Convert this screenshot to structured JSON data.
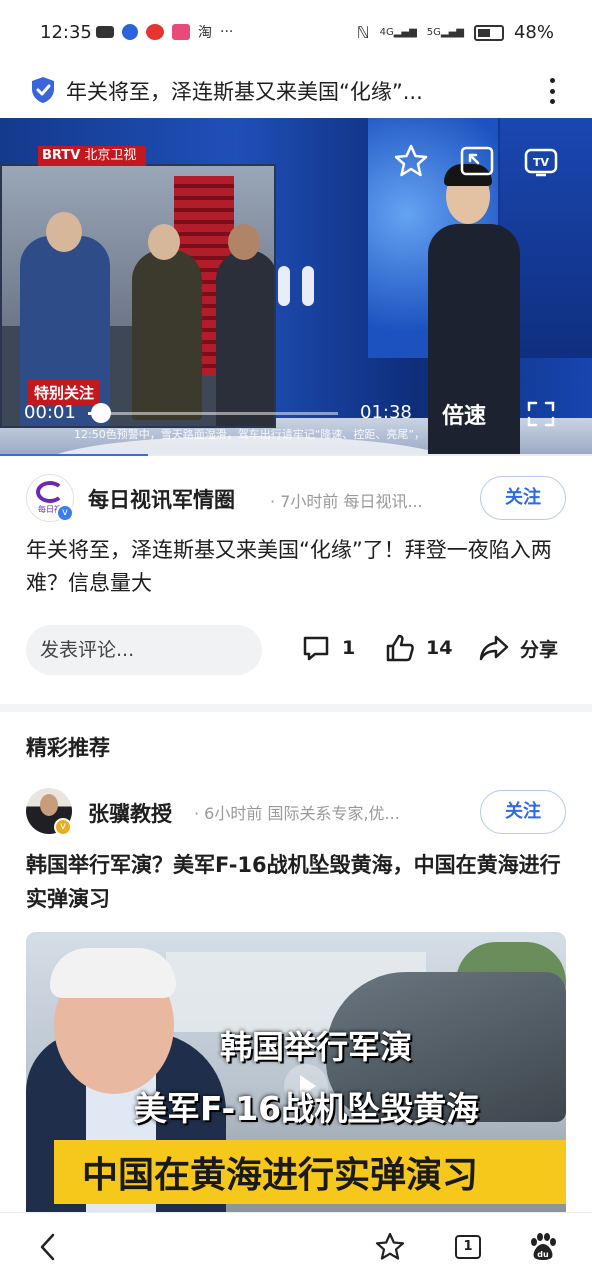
{
  "status_bar": {
    "time": "12:35",
    "left_icons": [
      "camera-icon",
      "paw-icon",
      "weibo-icon",
      "app-icon",
      "taobao-icon"
    ],
    "taobao_label": "淘",
    "more_dots": "···",
    "network_labels": [
      "4G",
      "5G"
    ],
    "battery_percent": "48%"
  },
  "title_bar": {
    "title": "年关将至，泽连斯基又来美国“化缘”..."
  },
  "video": {
    "channel_logo": "BRTV",
    "channel_name": "北京卫视",
    "special_tag": "特别关注",
    "current_time": "00:01",
    "duration": "01:38",
    "progress": 0.01,
    "speed_label": "倍速",
    "ticker_text": "12:50色预警中，雪天路面湿滑，驾车出行请牢记“降速、控距、亮尾”，"
  },
  "article": {
    "author_name": "每日视讯军情圈",
    "author_avatar_text": "每日视",
    "author_meta": "· 7小时前 每日视讯...",
    "follow_label": "关注",
    "title": "年关将至，泽连斯基又来美国“化缘”了！拜登一夜陷入两难？信息量大"
  },
  "actions": {
    "comment_placeholder": "发表评论...",
    "comment_count": "1",
    "like_count": "14",
    "share_label": "分享"
  },
  "recommend": {
    "section_title": "精彩推荐",
    "author_name": "张骥教授",
    "author_meta": "· 6小时前 国际关系专家,优...",
    "follow_label": "关注",
    "title": "韩国举行军演？美军F-16战机坠毁黄海，中国在黄海进行实弹演习",
    "thumb_captions": [
      "韩国举行军演",
      "美军F-16战机坠毁黄海",
      "中国在黄海进行实弹演习"
    ]
  },
  "bottom_nav": {
    "tab_count": "1"
  }
}
